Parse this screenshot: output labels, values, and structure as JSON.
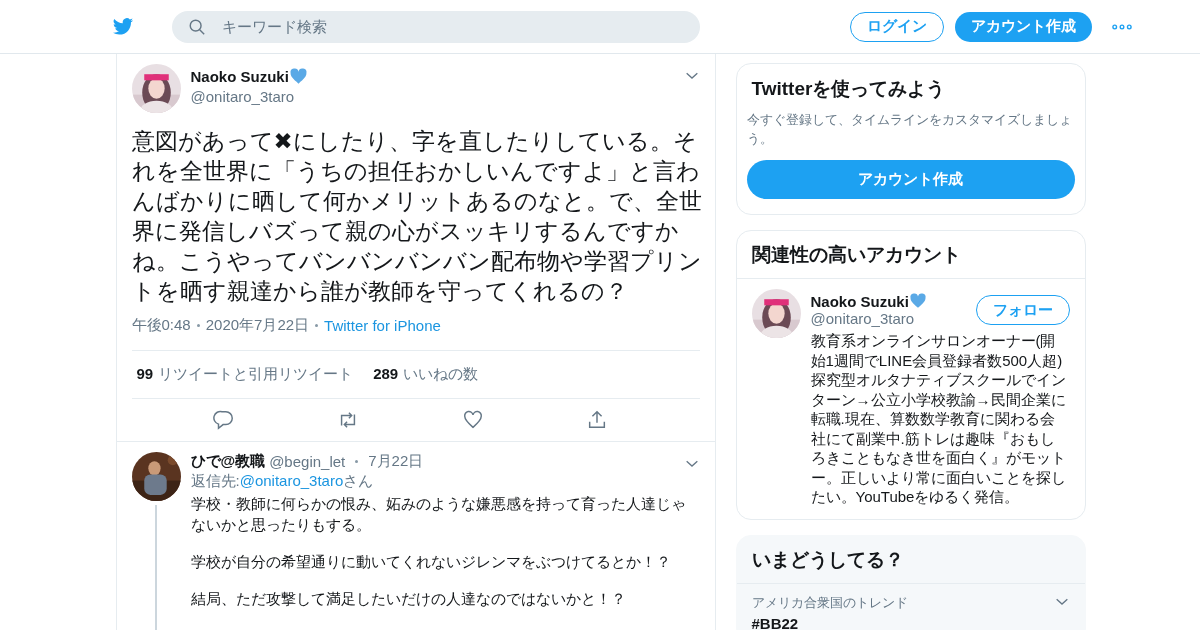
{
  "header": {
    "search_placeholder": "キーワード検索",
    "login_button": "ログイン",
    "signup_button": "アカウント作成"
  },
  "tweet": {
    "name": "Naoko Suzuki",
    "handle": "@onitaro_3taro",
    "text": "意図があって✖にしたり、字を直したりしている。それを全世界に「うちの担任おかしいんですよ」と言わんばかりに晒して何かメリットあるのなと。で、全世界に発信しバズって親の心がスッキリするんですかね。こうやってバンバンバンバン配布物や学習プリントを晒す親達から誰が教師を守ってくれるの？",
    "time": "午後0:48",
    "date": "2020年7月22日",
    "source": "Twitter for iPhone",
    "stats": [
      {
        "count": "99",
        "label": "リツイートと引用リツイート"
      },
      {
        "count": "289",
        "label": "いいねの数"
      }
    ]
  },
  "reply": {
    "name": "ひで@教職",
    "handle": "@begin_let",
    "date": "7月22日",
    "reply_to_label": "返信先:",
    "reply_to_handle": "@onitaro_3taro",
    "reply_to_suffix": "さん",
    "paragraphs": [
      "学校・教師に何らかの恨み、妬みのような嫌悪感を持って育った人達じゃないかと思ったりもする。",
      "学校が自分の希望通りに動いてくれないジレンマをぶつけてるとか！？",
      "結局、ただ攻撃して満足したいだけの人達なのではないかと！？"
    ]
  },
  "signup_card": {
    "title": "Twitterを使ってみよう",
    "description": "今すぐ登録して、タイムラインをカスタマイズしましょう。",
    "button": "アカウント作成"
  },
  "related": {
    "title": "関連性の高いアカウント",
    "name": "Naoko Suzuki",
    "handle": "@onitaro_3taro",
    "follow_button": "フォロー",
    "bio": "教育系オンラインサロンオーナー(開始1週間でLINE会員登録者数500人超)探究型オルタナティブスクールでインターン→公立小学校教諭→民間企業に転職.現在、算数数学教育に関わる会社にて副業中.筋トレは趣味『おもしろきこともなき世を面白く』がモットー。正しいより常に面白いことを探したい。YouTubeをゆるく発信。"
  },
  "trends": {
    "title": "いまどうしてる？",
    "items": [
      {
        "context": "アメリカ合衆国のトレンド",
        "name": "#BB22"
      }
    ]
  }
}
